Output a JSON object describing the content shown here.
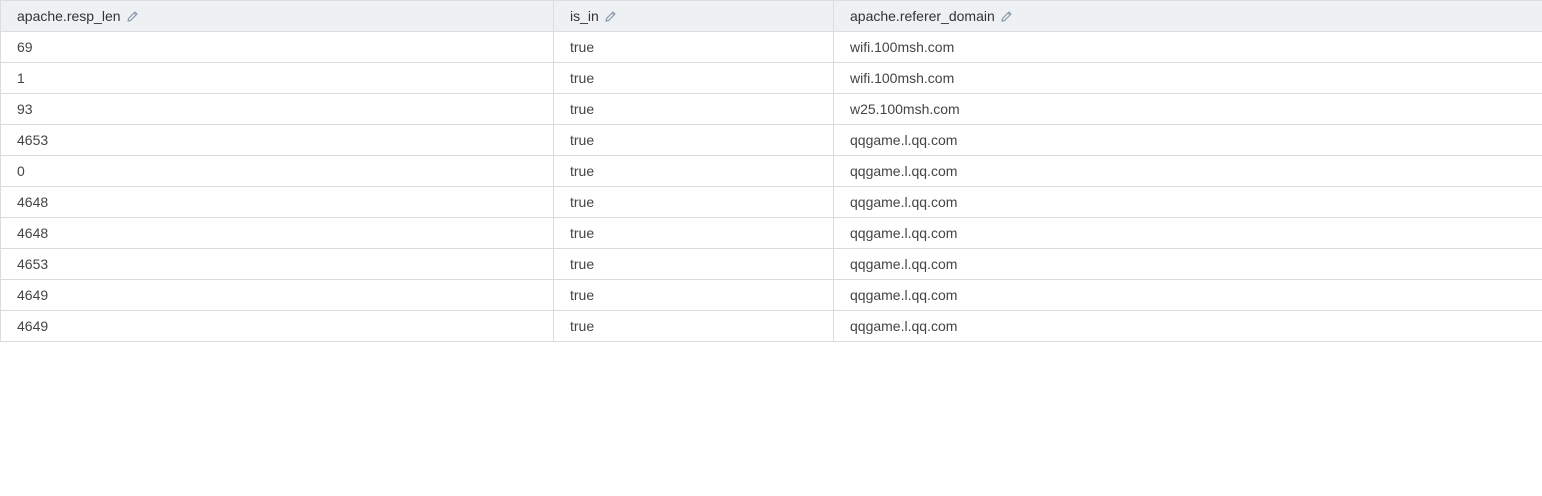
{
  "table": {
    "columns": [
      {
        "label": "apache.resp_len",
        "icon": "pencil-edit-icon"
      },
      {
        "label": "is_in",
        "icon": "pencil-edit-icon"
      },
      {
        "label": "apache.referer_domain",
        "icon": "pencil-edit-icon"
      }
    ],
    "rows": [
      [
        "69",
        "true",
        "wifi.100msh.com"
      ],
      [
        "1",
        "true",
        "wifi.100msh.com"
      ],
      [
        "93",
        "true",
        "w25.100msh.com"
      ],
      [
        "4653",
        "true",
        "qqgame.l.qq.com"
      ],
      [
        "0",
        "true",
        "qqgame.l.qq.com"
      ],
      [
        "4648",
        "true",
        "qqgame.l.qq.com"
      ],
      [
        "4648",
        "true",
        "qqgame.l.qq.com"
      ],
      [
        "4653",
        "true",
        "qqgame.l.qq.com"
      ],
      [
        "4649",
        "true",
        "qqgame.l.qq.com"
      ],
      [
        "4649",
        "true",
        "qqgame.l.qq.com"
      ]
    ]
  },
  "colors": {
    "header_bg": "#eef1f4",
    "border": "#dcdcdc",
    "icon": "#8a9aab"
  }
}
